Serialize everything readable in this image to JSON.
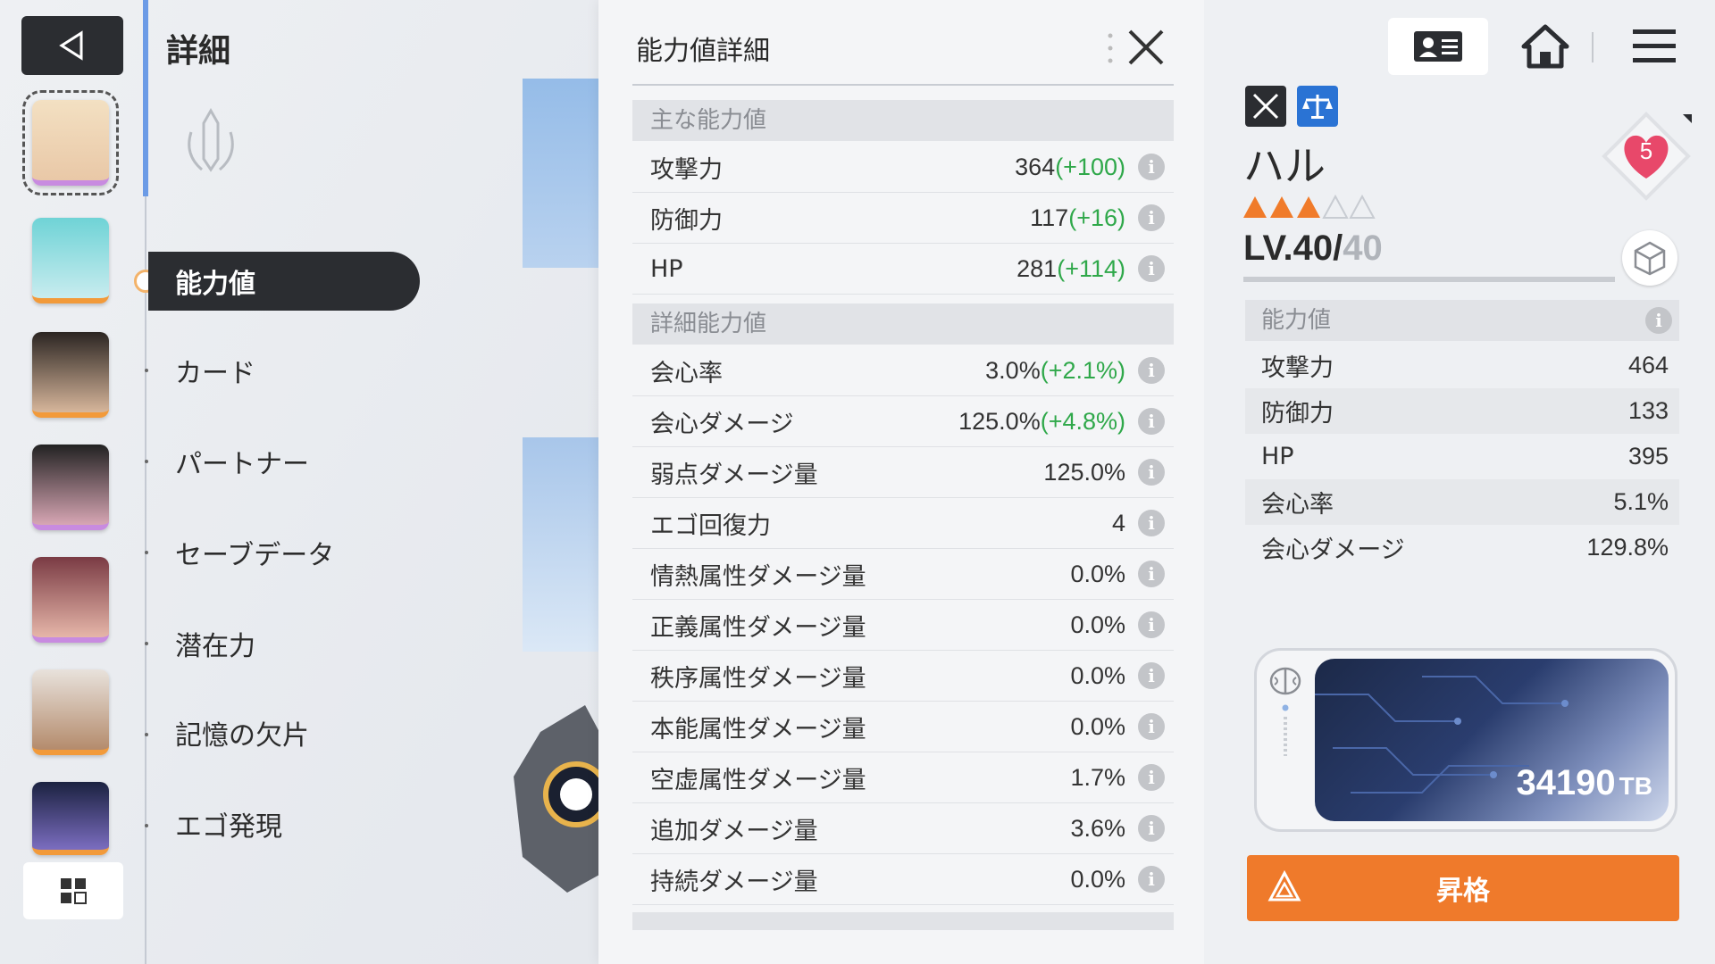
{
  "header": {
    "title": "詳細"
  },
  "menu": {
    "items": [
      {
        "label": "能力値",
        "active": true
      },
      {
        "label": "カード"
      },
      {
        "label": "パートナー"
      },
      {
        "label": "セーブデータ"
      },
      {
        "label": "潜在力"
      },
      {
        "label": "記憶の欠片"
      },
      {
        "label": "エゴ発現"
      }
    ]
  },
  "detail": {
    "title": "能力値詳細",
    "main_section": "主な能力値",
    "main_stats": [
      {
        "label": "攻撃力",
        "value": "364",
        "bonus": "(+100)"
      },
      {
        "label": "防御力",
        "value": "117",
        "bonus": "(+16)"
      },
      {
        "label": "HP",
        "value": "281",
        "bonus": "(+114)"
      }
    ],
    "detail_section": "詳細能力値",
    "detail_stats": [
      {
        "label": "会心率",
        "value": "3.0%",
        "bonus": "(+2.1%)"
      },
      {
        "label": "会心ダメージ",
        "value": "125.0%",
        "bonus": "(+4.8%)"
      },
      {
        "label": "弱点ダメージ量",
        "value": "125.0%",
        "bonus": ""
      },
      {
        "label": "エゴ回復力",
        "value": "4",
        "bonus": ""
      },
      {
        "label": "情熱属性ダメージ量",
        "value": "0.0%",
        "bonus": ""
      },
      {
        "label": "正義属性ダメージ量",
        "value": "0.0%",
        "bonus": ""
      },
      {
        "label": "秩序属性ダメージ量",
        "value": "0.0%",
        "bonus": ""
      },
      {
        "label": "本能属性ダメージ量",
        "value": "0.0%",
        "bonus": ""
      },
      {
        "label": "空虚属性ダメージ量",
        "value": "1.7%",
        "bonus": ""
      },
      {
        "label": "追加ダメージ量",
        "value": "3.6%",
        "bonus": ""
      },
      {
        "label": "持続ダメージ量",
        "value": "0.0%",
        "bonus": ""
      }
    ]
  },
  "character": {
    "name": "ハル",
    "rarity": {
      "filled": 3,
      "total": 5
    },
    "level_prefix": "LV.40/",
    "level_max": "40",
    "affinity": "5",
    "section": "能力値",
    "stats": [
      {
        "label": "攻撃力",
        "value": "464"
      },
      {
        "label": "防御力",
        "value": "133"
      },
      {
        "label": "HP",
        "value": "395"
      },
      {
        "label": "会心率",
        "value": "5.1%"
      },
      {
        "label": "会心ダメージ",
        "value": "129.8%"
      }
    ]
  },
  "storage": {
    "value": "34190",
    "unit": "TB"
  },
  "promote": {
    "label": "昇格"
  },
  "colors": {
    "accent": "#ef7a2b",
    "bonus": "#2fa84a",
    "dark": "#2b2d31"
  },
  "icons": [
    "back-icon",
    "grid-icon",
    "id-card-icon",
    "home-icon",
    "menu-icon",
    "close-icon",
    "info-icon",
    "sword-icon",
    "scale-icon",
    "heart-icon",
    "cube-icon",
    "brain-icon",
    "promote-icon"
  ]
}
